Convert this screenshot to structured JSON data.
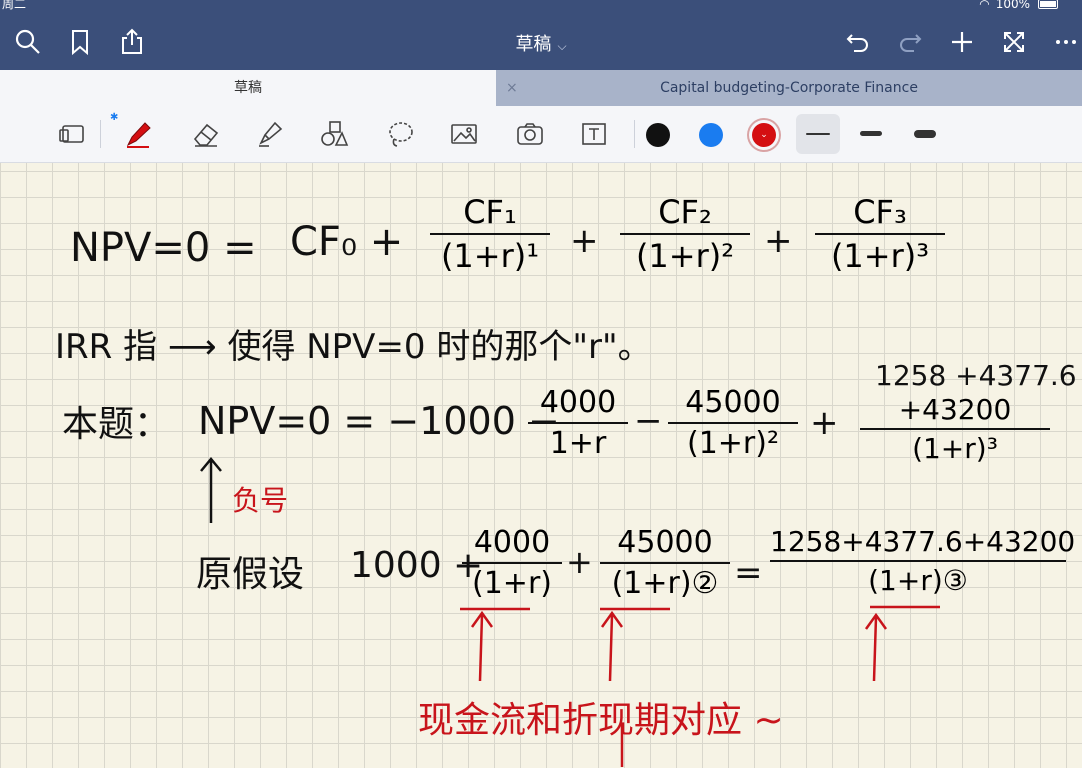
{
  "status_bar": {
    "day": "周二",
    "battery": "100%"
  },
  "nav": {
    "title": "草稿",
    "icons": [
      "search-icon",
      "bookmark-icon",
      "share-icon",
      "undo-icon",
      "redo-icon",
      "add-icon",
      "expand-icon",
      "more-icon"
    ]
  },
  "tabs": [
    {
      "label": "草稿",
      "active": true
    },
    {
      "label": "Capital budgeting-Corporate Finance",
      "active": false
    }
  ],
  "tab_close": "×",
  "toolbar": {
    "tools": [
      "page-view-icon",
      "pen-icon",
      "eraser-icon",
      "highlighter-icon",
      "shapes-icon",
      "lasso-icon",
      "image-icon",
      "camera-icon",
      "text-icon"
    ],
    "colors": [
      "#111111",
      "#1a7cf0",
      "#d40f12"
    ],
    "selected_color": "#d40f12",
    "thickness_options": [
      "thin",
      "medium",
      "thick"
    ],
    "selected_thickness": "thin"
  },
  "notes": {
    "line1": {
      "lhs": "NPV=0 =",
      "cf0": "CF₀ +",
      "f1_num": "CF₁",
      "f1_den": "(1+r)¹",
      "plus1": "+",
      "f2_num": "CF₂",
      "f2_den": "(1+r)²",
      "plus2": "+",
      "f3_num": "CF₃",
      "f3_den": "(1+r)³"
    },
    "line2": "IRR 指 ⟶ 使得 NPV=0 时的那个\"r\"。",
    "line3": {
      "label": "本题：",
      "expr": "NPV=0 = −1000 −",
      "f1_num": "4000",
      "f1_den": "1+r",
      "minus": "−",
      "f2_num": "45000",
      "f2_den": "(1+r)²",
      "plus": "+",
      "f3_top": "1258 +4377.6",
      "f3_num": "+43200",
      "f3_den": "(1+r)³"
    },
    "arrow_note": "负号",
    "line4": {
      "label": "原假设",
      "expr": "1000 +",
      "f1_num": "4000",
      "f1_den": "(1+r)",
      "plus": "+",
      "f2_num": "45000",
      "f2_den": "(1+r)②",
      "eq": "=",
      "f3_num": "1258+4377.6+43200",
      "f3_den": "(1+r)③"
    },
    "red_note": "现金流和折现期对应 ~"
  }
}
